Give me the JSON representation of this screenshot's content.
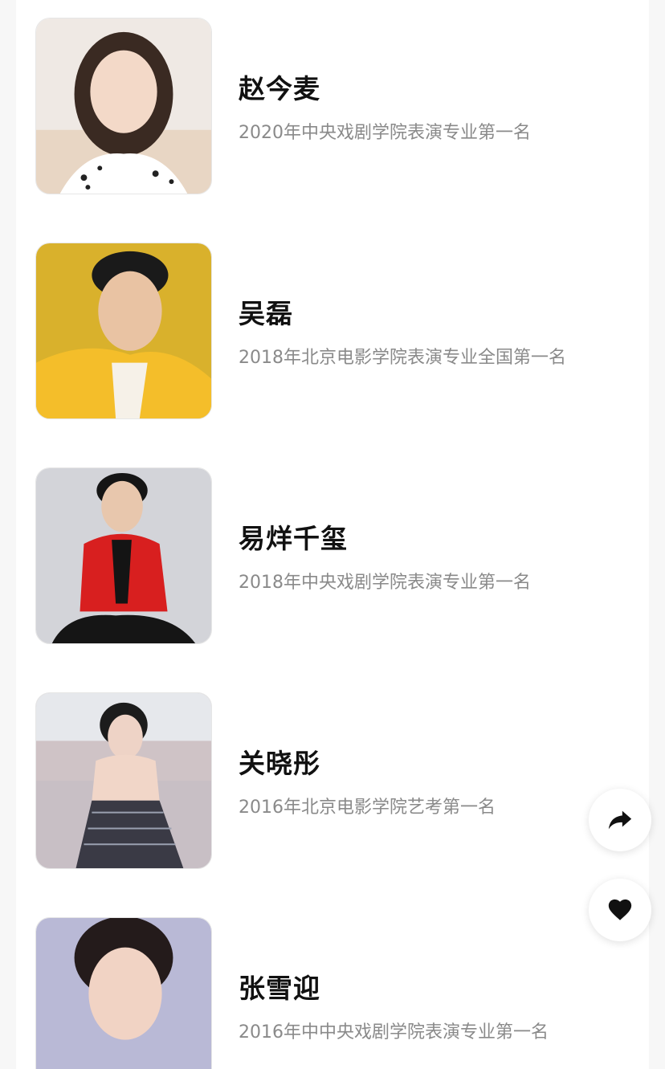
{
  "items": [
    {
      "name": "赵今麦",
      "description": "2020年中央戏剧学院表演专业第一名"
    },
    {
      "name": "吴磊",
      "description": "2018年北京电影学院表演专业全国第一名"
    },
    {
      "name": "易烊千玺",
      "description": "2018年中央戏剧学院表演专业第一名"
    },
    {
      "name": "关晓彤",
      "description": "2016年北京电影学院艺考第一名"
    },
    {
      "name": "张雪迎",
      "description": "2016年中中央戏剧学院表演专业第一名"
    }
  ],
  "actions": {
    "share_icon": "share-arrow-icon",
    "like_icon": "heart-icon"
  },
  "colors": {
    "name_text": "#111111",
    "desc_text": "#8a8a8a",
    "icon": "#111111",
    "background": "#f7f7f7",
    "panel": "#ffffff"
  }
}
